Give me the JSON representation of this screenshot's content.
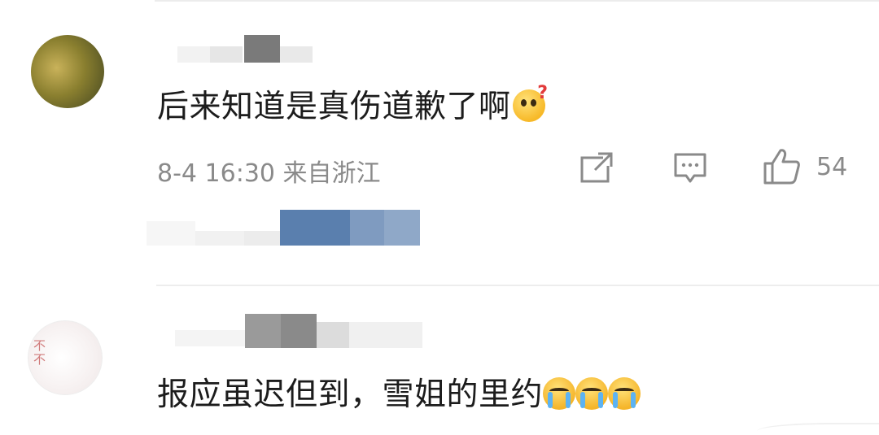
{
  "comments": [
    {
      "text": "后来知道是真伤道歉了啊",
      "emojis": [
        "thinking-face-with-question-mark"
      ],
      "time": "8-4 16:30 来自浙江",
      "like_count": "54",
      "actions": [
        "share",
        "reply",
        "like"
      ]
    },
    {
      "text": "报应虽迟但到，雪姐的里约",
      "emojis": [
        "loudly-crying-face",
        "loudly-crying-face",
        "loudly-crying-face"
      ]
    }
  ],
  "colors": {
    "text": "#1c1c1c",
    "meta": "#8a8a8a",
    "divider": "#ededed",
    "reply_preview_blue": "#5a7fae"
  }
}
